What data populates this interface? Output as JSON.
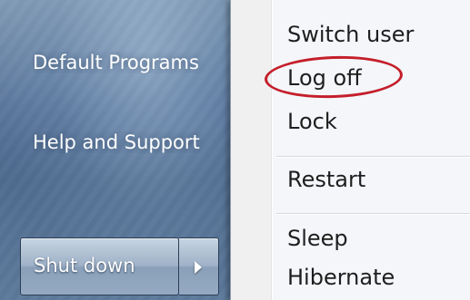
{
  "start_menu": {
    "items": [
      {
        "label": "Default Programs"
      },
      {
        "label": "Help and Support"
      }
    ],
    "shutdown_button": {
      "label": "Shut down"
    }
  },
  "shutdown_menu": {
    "items": [
      {
        "label": "Switch user"
      },
      {
        "label": "Log off",
        "highlighted": true
      },
      {
        "label": "Lock"
      },
      {
        "label": "Restart"
      },
      {
        "label": "Sleep"
      },
      {
        "label": "Hibernate"
      }
    ]
  },
  "icons": {
    "shutdown_arrow": "chevron-right-icon"
  },
  "colors": {
    "highlight_ellipse": "#c41e2a",
    "menu_background": "#f4f6fa",
    "menu_text": "#1e1e1e"
  }
}
